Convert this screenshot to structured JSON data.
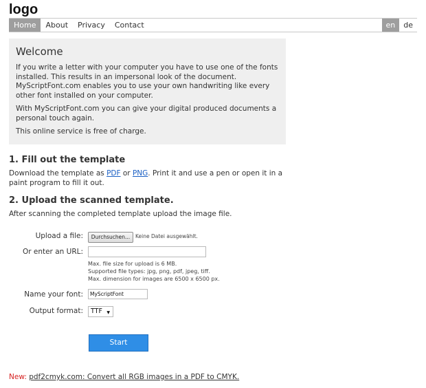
{
  "logo": "logo",
  "nav": {
    "items": [
      "Home",
      "About",
      "Privacy",
      "Contact"
    ],
    "languages": [
      "en",
      "de"
    ]
  },
  "welcome": {
    "title": "Welcome",
    "p1": "If you write a letter with your computer you have to use one of the fonts installed. This results in an impersonal look of the document. MyScriptFont.com enables you to use your own handwriting like every other font installed on your computer.",
    "p2": "With MyScriptFont.com you can give your digital produced documents a personal touch again.",
    "p3": "This online service is free of charge."
  },
  "step1": {
    "title": "1. Fill out the template",
    "text_before": "Download the template as ",
    "pdf_link": "PDF",
    "or": " or ",
    "png_link": "PNG",
    "text_after": ". Print it and use a pen or open it in a paint program to fill it out."
  },
  "step2": {
    "title": "2. Upload the scanned template.",
    "text": "After scanning the completed template upload the image file."
  },
  "form": {
    "upload_label": "Upload a file:",
    "browse_button": "Durchsuchen...",
    "no_file": "Keine Datei ausgewählt.",
    "url_label": "Or enter an URL:",
    "url_value": "",
    "info1": "Max. file size for upload is 6 MB.",
    "info2": "Supported file types: jpg, png, pdf, jpeg, tiff.",
    "info3": "Max. dimension for images are 6500 x 6500 px.",
    "name_label": "Name your font:",
    "name_value": "MyScriptFont",
    "format_label": "Output format:",
    "format_value": "TTF",
    "start_button": "Start"
  },
  "footer": {
    "new_label": "New:",
    "link_text": "pdf2cmyk.com: Convert all RGB images in a PDF to CMYK."
  }
}
